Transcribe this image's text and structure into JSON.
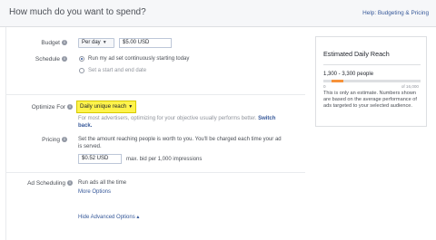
{
  "header": {
    "title": "How much do you want to spend?",
    "help_link": "Help: Budgeting & Pricing"
  },
  "budget": {
    "label": "Budget",
    "frequency": "Per day",
    "amount": "$5.00 USD"
  },
  "schedule": {
    "label": "Schedule",
    "options": [
      {
        "label": "Run my ad set continuously starting today",
        "checked": true
      },
      {
        "label": "Set a start and end date",
        "checked": false
      }
    ]
  },
  "optimize": {
    "label": "Optimize For",
    "value": "Daily unique reach",
    "note": "For most advertisers, optimizing for your objective usually performs better.",
    "switch_link": "Switch",
    "switch_link_2": "back."
  },
  "pricing": {
    "label": "Pricing",
    "description_line1": "Set the amount reaching people is worth to you. You'll be charged each time your ad",
    "description_line2": "is served.",
    "bid": "$0.52 USD",
    "bid_suffix": "max. bid per 1,000 impressions"
  },
  "ad_scheduling": {
    "label": "Ad Scheduling",
    "value": "Run ads all the time",
    "more_link": "More Options"
  },
  "advanced_link": "Hide Advanced Options ▴",
  "reach_panel": {
    "title": "Estimated Daily Reach",
    "range": "1,300 - 3,300 people",
    "min_label": "0",
    "max_label": "of 16,000",
    "fill_start_fraction": 0.08,
    "fill_end_fraction": 0.21,
    "note": "This is only an estimate. Numbers shown are based on the average performance of ads targeted to your selected audience."
  },
  "icons": {
    "info": "info-icon",
    "dropdown": "chevron-down-icon"
  },
  "colors": {
    "highlight": "#fff34c",
    "reach_bar": "#f7923a",
    "link": "#365899"
  }
}
